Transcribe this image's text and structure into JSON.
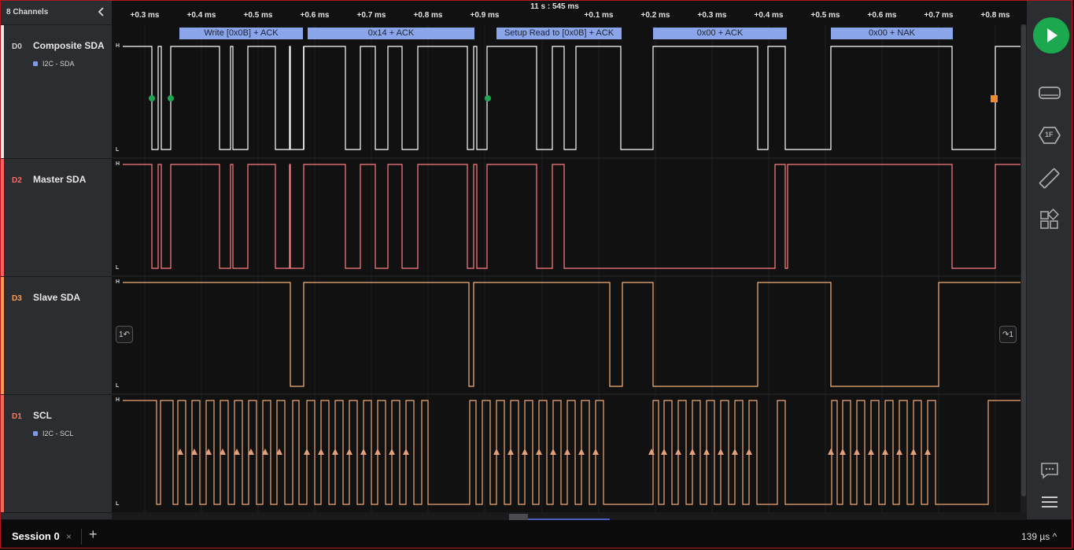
{
  "panel": {
    "channels_label": "8 Channels"
  },
  "channels": [
    {
      "num": "D0",
      "name": "Composite SDA",
      "analyzer": "I2C - SDA",
      "color": "#ffffff",
      "bar": "#e8e8e8"
    },
    {
      "num": "D2",
      "name": "Master SDA",
      "analyzer": "",
      "color": "#ff7d82",
      "bar": "#ff5e5e"
    },
    {
      "num": "D3",
      "name": "Slave SDA",
      "analyzer": "",
      "color": "#f7b27a",
      "bar": "#f59a4c"
    },
    {
      "num": "D1",
      "name": "SCL",
      "analyzer": "I2C - SCL",
      "color": "#f1a978",
      "bar": "#e96c55"
    }
  ],
  "timeline": {
    "absolute": "11 s : 545 ms",
    "ticks": [
      "+0.3 ms",
      "+0.4 ms",
      "+0.5 ms",
      "+0.6 ms",
      "+0.7 ms",
      "+0.8 ms",
      "+0.9 ms",
      "+0.1 ms",
      "+0.2 ms",
      "+0.3 ms",
      "+0.4 ms",
      "+0.5 ms",
      "+0.6 ms",
      "+0.7 ms",
      "+0.8 ms"
    ]
  },
  "protocol": [
    "Write [0x0B] + ACK",
    "0x14 + ACK",
    "Setup Read to [0x0B] + ACK",
    "0x00 + ACK",
    "0x00 + NAK"
  ],
  "levels": {
    "high": "H",
    "low": "L"
  },
  "colors": {
    "start_marker": "#1fa655",
    "stop_marker": "#f08a2e",
    "protocol_bg": "#8aa5ea",
    "accent": "#1ca84f"
  },
  "sidebar": {
    "run_icon": "play-icon",
    "icons": [
      "device-icon",
      "analyzer-icon",
      "measure-icon",
      "extensions-icon",
      "chat-icon",
      "menu-icon"
    ],
    "analyzer_badge": "1F"
  },
  "session": {
    "tab": "Session 0",
    "close": "×",
    "add": "+",
    "zoom": "139 µs ^"
  },
  "trigger_icons": {
    "left": "1↶",
    "right": "↷1"
  }
}
